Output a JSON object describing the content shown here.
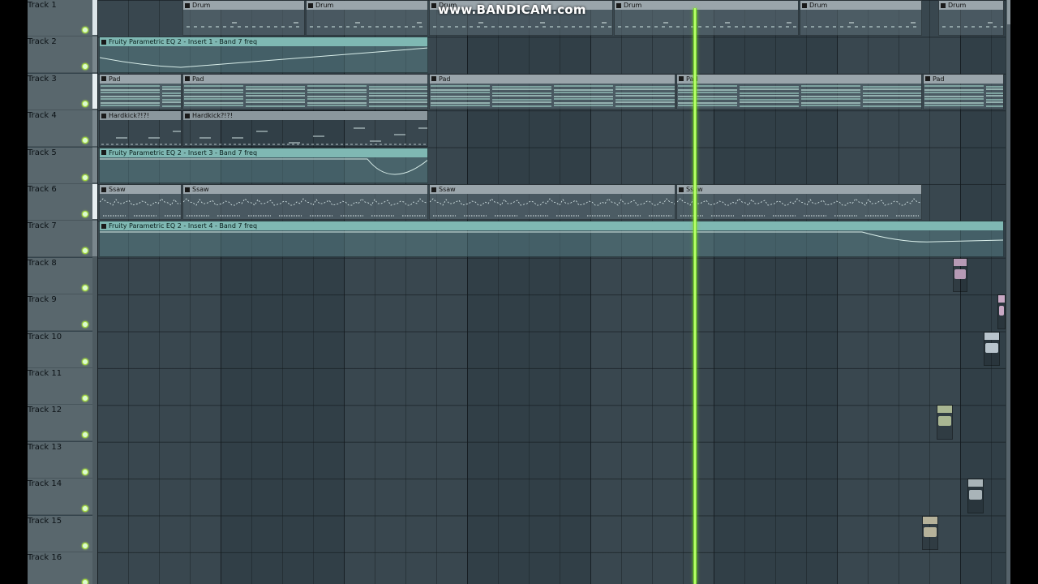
{
  "watermark": "www.BANDICAM.com",
  "tracks": [
    "Track 1",
    "Track 2",
    "Track 3",
    "Track 4",
    "Track 5",
    "Track 6",
    "Track 7",
    "Track 8",
    "Track 9",
    "Track 10",
    "Track 11",
    "Track 12",
    "Track 13",
    "Track 14",
    "Track 15",
    "Track 16"
  ],
  "clips": [
    {
      "track": 0,
      "start": 225,
      "end": 376,
      "label": "Drum",
      "kind": "pattern",
      "pattern": "drum"
    },
    {
      "track": 0,
      "start": 377,
      "end": 528,
      "label": "Drum",
      "kind": "pattern",
      "pattern": "drum"
    },
    {
      "track": 0,
      "start": 529,
      "end": 756,
      "label": "Drum",
      "kind": "pattern",
      "pattern": "drum"
    },
    {
      "track": 0,
      "start": 757,
      "end": 985,
      "label": "Drum",
      "kind": "pattern",
      "pattern": "drum"
    },
    {
      "track": 0,
      "start": 986,
      "end": 1137,
      "label": "Drum",
      "kind": "pattern",
      "pattern": "drum"
    },
    {
      "track": 0,
      "start": 1157,
      "end": 1238,
      "label": "Drum",
      "kind": "pattern",
      "pattern": "drum"
    },
    {
      "track": 1,
      "start": 122,
      "end": 528,
      "label": "Fruity Parametric EQ 2 - Insert 1 - Band 7 freq",
      "kind": "auto",
      "pattern": "auto1"
    },
    {
      "track": 2,
      "start": 122,
      "end": 224,
      "label": "Pad",
      "kind": "pattern",
      "pattern": "pad"
    },
    {
      "track": 2,
      "start": 225,
      "end": 528,
      "label": "Pad",
      "kind": "pattern",
      "pattern": "pad"
    },
    {
      "track": 2,
      "start": 529,
      "end": 833,
      "label": "Pad",
      "kind": "pattern",
      "pattern": "pad"
    },
    {
      "track": 2,
      "start": 834,
      "end": 1137,
      "label": "Pad",
      "kind": "pattern",
      "pattern": "pad"
    },
    {
      "track": 2,
      "start": 1138,
      "end": 1238,
      "label": "Pad",
      "kind": "pattern",
      "pattern": "pad"
    },
    {
      "track": 3,
      "start": 122,
      "end": 224,
      "label": "Hardkick?!?!",
      "kind": "hkick",
      "pattern": "kick"
    },
    {
      "track": 3,
      "start": 225,
      "end": 528,
      "label": "Hardkick?!?!",
      "kind": "hkick",
      "pattern": "kick"
    },
    {
      "track": 4,
      "start": 122,
      "end": 528,
      "label": "Fruity Parametric EQ 2 - Insert 3 - Band 7 freq",
      "kind": "auto",
      "pattern": "auto3"
    },
    {
      "track": 5,
      "start": 122,
      "end": 224,
      "label": "Ssaw",
      "kind": "pattern",
      "pattern": "saw"
    },
    {
      "track": 5,
      "start": 225,
      "end": 528,
      "label": "Ssaw",
      "kind": "pattern",
      "pattern": "saw"
    },
    {
      "track": 5,
      "start": 529,
      "end": 833,
      "label": "Ssaw",
      "kind": "pattern",
      "pattern": "saw"
    },
    {
      "track": 5,
      "start": 834,
      "end": 1137,
      "label": "Ssaw",
      "kind": "pattern",
      "pattern": "saw"
    },
    {
      "track": 6,
      "start": 122,
      "end": 1238,
      "label": "Fruity Parametric EQ 2 - Insert 4 - Band 7 freq",
      "kind": "auto",
      "pattern": "auto4"
    }
  ],
  "audio_clips": [
    {
      "track": 7,
      "start": 1175,
      "end": 1193,
      "color": "#b69ab5"
    },
    {
      "track": 8,
      "start": 1230,
      "end": 1240,
      "color": "#c8a8c4"
    },
    {
      "track": 9,
      "start": 1213,
      "end": 1233,
      "color": "#b8c4cc"
    },
    {
      "track": 11,
      "start": 1155,
      "end": 1175,
      "color": "#a9b692"
    },
    {
      "track": 13,
      "start": 1193,
      "end": 1213,
      "color": "#a9b4b8"
    },
    {
      "track": 14,
      "start": 1137,
      "end": 1157,
      "color": "#b6b29a"
    }
  ],
  "playhead_bar_fraction": 0.66
}
